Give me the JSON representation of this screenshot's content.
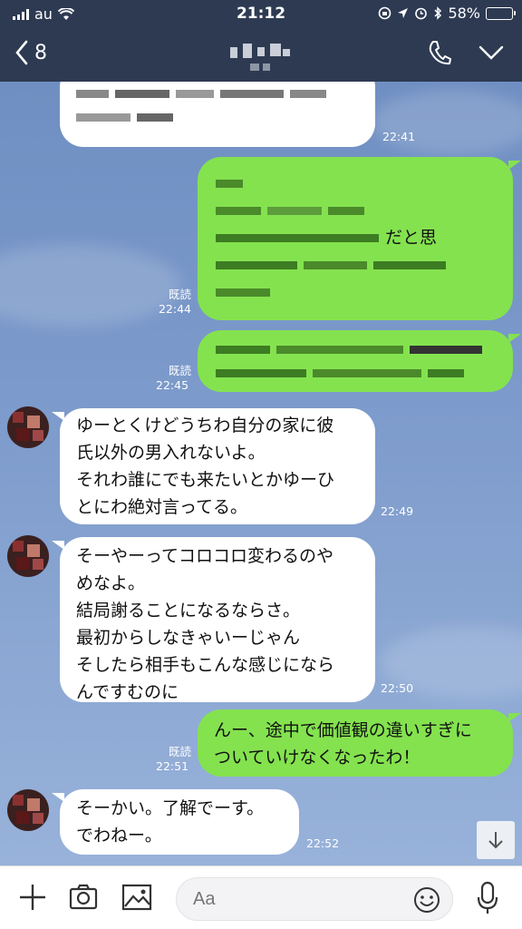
{
  "status_bar": {
    "carrier": "au",
    "time": "21:12",
    "battery": "58%",
    "battery_level": 0.58
  },
  "header": {
    "back_count": "8"
  },
  "messages": [
    {
      "dir": "in",
      "time": "22:41",
      "text": ""
    },
    {
      "dir": "out",
      "time": "22:44",
      "read": "既読",
      "text": "だと思"
    },
    {
      "dir": "out",
      "time": "22:45",
      "read": "既読",
      "text": ""
    },
    {
      "dir": "in",
      "time": "22:49",
      "text": "ゆーとくけどうちわ自分の家に彼\n氏以外の男入れないよ。\nそれわ誰にでも来たいとかゆーひ\nとにわ絶対言ってる。"
    },
    {
      "dir": "in",
      "time": "22:50",
      "text": "そーやーってコロコロ変わるのや\nめなよ。\n結局謝ることになるならさ。\n最初からしなきゃいーじゃん\nそしたら相手もこんな感じになら\nんですむのに"
    },
    {
      "dir": "out",
      "time": "22:51",
      "read": "既読",
      "text": "んー、途中で価値観の違いすぎに\nついていけなくなったわ！"
    },
    {
      "dir": "in",
      "time": "22:52",
      "text": "そーかい。了解でーす。\nでわねー。"
    }
  ],
  "input": {
    "placeholder": "Aa"
  },
  "icons": [
    "back-chevron-icon",
    "phone-icon",
    "chevron-down-icon",
    "plus-icon",
    "camera-icon",
    "image-icon",
    "emoji-icon",
    "microphone-icon",
    "scroll-down-arrow-icon"
  ],
  "colors": {
    "header_bg": "#2d3a52",
    "outgoing_bubble": "#84e24f",
    "incoming_bubble": "#ffffff",
    "chat_bg": "#7e9bc9"
  }
}
